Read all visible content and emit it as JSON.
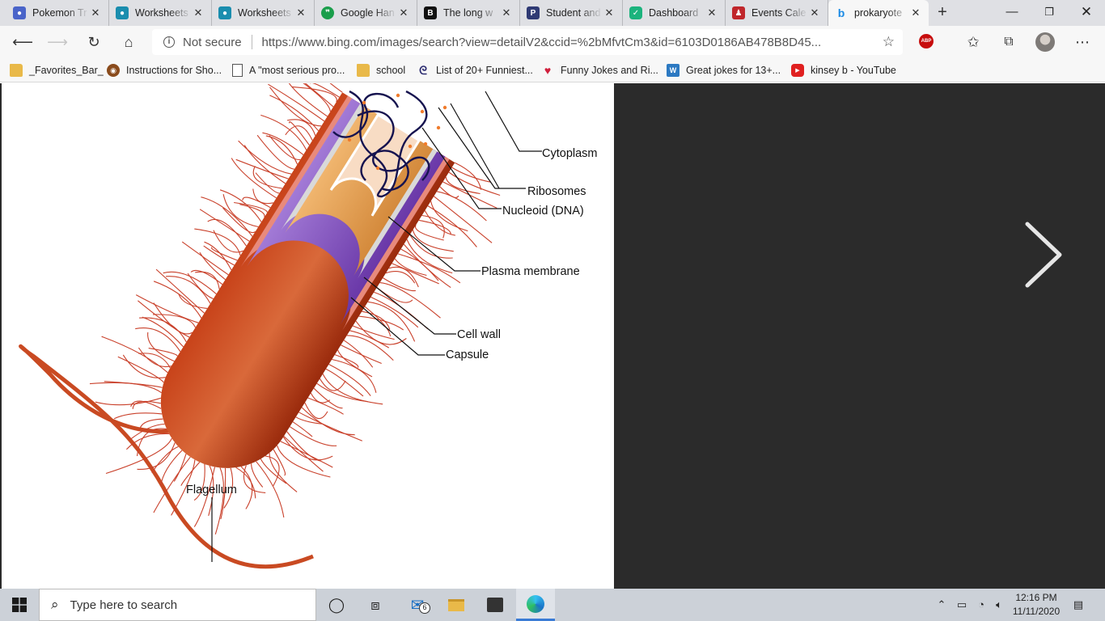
{
  "browser": {
    "tabs": [
      {
        "title": "Pokemon Tr",
        "favicon": "teams-icon",
        "color": "#4a64c9"
      },
      {
        "title": "Worksheets",
        "favicon": "classroom-icon",
        "color": "#1a8dae"
      },
      {
        "title": "Worksheets",
        "favicon": "classroom-icon",
        "color": "#1a8dae"
      },
      {
        "title": "Google Han",
        "favicon": "hangouts-icon",
        "color": "#1a9e4b"
      },
      {
        "title": "The long w",
        "favicon": "b-icon",
        "color": "#111111"
      },
      {
        "title": "Student and",
        "favicon": "p-icon",
        "color": "#2f3a74"
      },
      {
        "title": "Dashboard",
        "favicon": "hex-icon",
        "color": "#1bb37d"
      },
      {
        "title": "Events Cale",
        "favicon": "people-icon",
        "color": "#c0262b"
      },
      {
        "title": "prokaryote",
        "favicon": "bing-icon",
        "color": "#1a8ae5",
        "active": true
      }
    ],
    "address": {
      "security_label": "Not secure",
      "url": "https://www.bing.com/images/search?view=detailV2&ccid=%2bMfvtCm3&id=6103D0186AB478B8D45..."
    },
    "extension_label": "ABP",
    "favorites": [
      {
        "label": "_Favorites_Bar_",
        "icon": "folder-icon"
      },
      {
        "label": "Instructions for Sho...",
        "icon": "globe-icon"
      },
      {
        "label": "A \"most serious pro...",
        "icon": "page-icon"
      },
      {
        "label": "school",
        "icon": "folder-icon"
      },
      {
        "label": "List of 20+ Funniest...",
        "icon": "swirl-icon"
      },
      {
        "label": "Funny Jokes and Ri...",
        "icon": "heart-icon"
      },
      {
        "label": "Great jokes for 13+...",
        "icon": "w-icon"
      },
      {
        "label": "kinsey b - YouTube",
        "icon": "youtube-icon"
      }
    ]
  },
  "diagram": {
    "labels": {
      "cytoplasm": "Cytoplasm",
      "ribosomes": "Ribosomes",
      "nucleoid": "Nucleoid (DNA)",
      "plasma_membrane": "Plasma membrane",
      "cell_wall": "Cell wall",
      "capsule": "Capsule",
      "flagellum": "Flagellum"
    }
  },
  "taskbar": {
    "search_placeholder": "Type here to search",
    "mail_badge": "6",
    "time": "12:16 PM",
    "date": "11/11/2020"
  }
}
